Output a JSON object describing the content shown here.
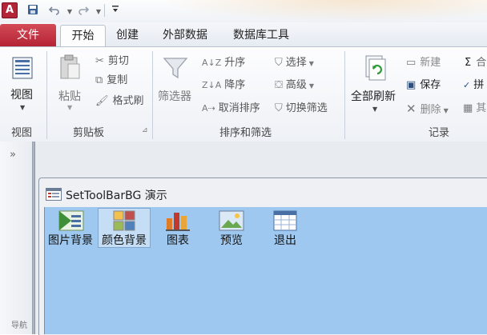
{
  "title_bar": {
    "app_icon_letter": "A",
    "qat_icons": [
      "save-icon",
      "undo-icon",
      "redo-icon",
      "customize-icon"
    ]
  },
  "ribbon_tabs": {
    "file": "文件",
    "home": "开始",
    "create": "创建",
    "external_data": "外部数据",
    "database_tools": "数据库工具"
  },
  "ribbon": {
    "views": {
      "view_button": "视图",
      "label": "视图"
    },
    "clipboard": {
      "paste": "粘贴",
      "cut": "剪切",
      "copy": "复制",
      "format_painter": "格式刷",
      "label": "剪贴板"
    },
    "sort_filter": {
      "filter": "筛选器",
      "ascending": "升序",
      "descending": "降序",
      "remove_sort": "取消排序",
      "selection": "选择",
      "advanced": "高级",
      "toggle_filter": "切换筛选",
      "label": "排序和筛选"
    },
    "records": {
      "refresh_all": "全部刷新",
      "new": "新建",
      "save": "保存",
      "delete": "删除",
      "label": "记录"
    },
    "truncated": {
      "totals": "合",
      "spelling": "拼",
      "more": "其"
    }
  },
  "nav_pane": {
    "expand_glyph": "»",
    "vertical_text": "导航"
  },
  "form": {
    "title": "SetToolBarBG 演示",
    "toolbar": [
      {
        "label": "图片背景",
        "icon": "picture-background-icon"
      },
      {
        "label": "颜色背景",
        "icon": "color-background-icon"
      },
      {
        "label": "图表",
        "icon": "chart-icon"
      },
      {
        "label": "预览",
        "icon": "preview-icon"
      },
      {
        "label": "退出",
        "icon": "exit-icon"
      }
    ]
  },
  "colors": {
    "file_tab": "#c0303f",
    "toolbar_bg": "#9ec8ef"
  }
}
